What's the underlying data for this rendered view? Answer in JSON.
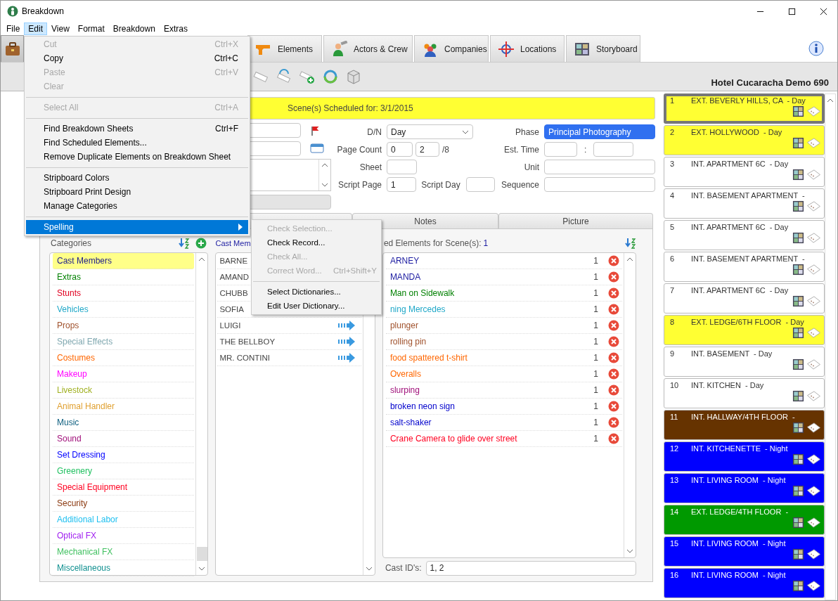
{
  "window": {
    "title": "Breakdown"
  },
  "menu_bar": [
    {
      "label": "File",
      "selected": false
    },
    {
      "label": "Edit",
      "selected": true
    },
    {
      "label": "View",
      "selected": false
    },
    {
      "label": "Format",
      "selected": false
    },
    {
      "label": "Breakdown",
      "selected": false
    },
    {
      "label": "Extras",
      "selected": false
    }
  ],
  "module_tabs": [
    {
      "kind": "briefcase",
      "selected": true
    },
    {
      "kind": "gun",
      "label": "Elements",
      "selected": false
    },
    {
      "kind": "actor",
      "label": "Actors & Crew",
      "selected": false
    },
    {
      "kind": "people",
      "label": "Companies",
      "selected": false
    },
    {
      "kind": "compass",
      "label": "Locations",
      "selected": false
    },
    {
      "kind": "storyboard",
      "label": "Storyboard",
      "selected": false
    }
  ],
  "project_name": "Hotel Cucaracha Demo 690",
  "schedule_banner": "Scene(s) Scheduled for: 3/1/2015",
  "form": {
    "dn_label": "D/N",
    "dn_value": "Day",
    "phase_label": "Phase",
    "phase_value": "Principal Photography",
    "phase_highlighted": true,
    "page_count_label": "Page Count",
    "page_count_whole": "0",
    "page_count_eighths": "2",
    "page_count_suffix": "/8",
    "est_time_label": "Est. Time",
    "est_time_separator": ":",
    "sheet_label": "Sheet",
    "unit_label": "Unit",
    "script_page_label": "Script Page",
    "script_page_value": "1",
    "script_day_label": "Script Day",
    "sequence_label": "Sequence"
  },
  "panel_tabs": [
    {
      "label": "Notes",
      "selected": false
    },
    {
      "label": "Picture",
      "selected": false
    }
  ],
  "categories": {
    "header": "Categories",
    "items": [
      {
        "label": "Cast Members",
        "color": "#1a1a8c",
        "selected": true
      },
      {
        "label": "Extras",
        "color": "#008000",
        "selected": false
      },
      {
        "label": "Stunts",
        "color": "#e00020",
        "selected": false
      },
      {
        "label": "Vehicles",
        "color": "#20a8c8",
        "selected": false
      },
      {
        "label": "Props",
        "color": "#a0522d",
        "selected": false
      },
      {
        "label": "Special Effects",
        "color": "#80a8b0",
        "selected": false
      },
      {
        "label": "Costumes",
        "color": "#ff6600",
        "selected": false
      },
      {
        "label": "Makeup",
        "color": "#ff00ff",
        "selected": false
      },
      {
        "label": "Livestock",
        "color": "#a0b020",
        "selected": false
      },
      {
        "label": "Animal Handler",
        "color": "#e0a030",
        "selected": false
      },
      {
        "label": "Music",
        "color": "#106080",
        "selected": false
      },
      {
        "label": "Sound",
        "color": "#a0107a",
        "selected": false
      },
      {
        "label": "Set Dressing",
        "color": "#0000ff",
        "selected": false
      },
      {
        "label": "Greenery",
        "color": "#20c060",
        "selected": false
      },
      {
        "label": "Special Equipment",
        "color": "#ff0020",
        "selected": false
      },
      {
        "label": "Security",
        "color": "#8b3a10",
        "selected": false
      },
      {
        "label": "Additional Labor",
        "color": "#20c0f0",
        "selected": false
      },
      {
        "label": "Optical FX",
        "color": "#a020f0",
        "selected": false
      },
      {
        "label": "Mechanical FX",
        "color": "#40c060",
        "selected": false
      },
      {
        "label": "Miscellaneous",
        "color": "#109090",
        "selected": false
      }
    ]
  },
  "cast": {
    "header": "Cast Mem",
    "items": [
      {
        "name": "BARNE",
        "arrow": false
      },
      {
        "name": "AMAND",
        "arrow": false
      },
      {
        "name": "CHUBB",
        "arrow": false
      },
      {
        "name": "SOFIA",
        "arrow": false
      },
      {
        "name": "LUIGI",
        "arrow": true
      },
      {
        "name": "THE BELLBOY",
        "arrow": true
      },
      {
        "name": "MR. CONTINI",
        "arrow": true
      }
    ]
  },
  "elements": {
    "header": "ed Elements for Scene(s):",
    "count": "1",
    "items": [
      {
        "label": "ARNEY",
        "color": "#1a1aa0",
        "quantity": "1"
      },
      {
        "label": "MANDA",
        "color": "#1a1aa0",
        "quantity": "1"
      },
      {
        "label": "Man on Sidewalk",
        "color": "#008000",
        "quantity": "1"
      },
      {
        "label": "ning Mercedes",
        "color": "#20a8c8",
        "quantity": "1"
      },
      {
        "label": "plunger",
        "color": "#a0522d",
        "quantity": "1"
      },
      {
        "label": "rolling pin",
        "color": "#a0522d",
        "quantity": "1"
      },
      {
        "label": "food spattered t-shirt",
        "color": "#ff6600",
        "quantity": "1"
      },
      {
        "label": "Overalls",
        "color": "#ff6600",
        "quantity": "1"
      },
      {
        "label": "slurping",
        "color": "#a0107a",
        "quantity": "1"
      },
      {
        "label": "broken neon sign",
        "color": "#0000cc",
        "quantity": "1"
      },
      {
        "label": "salt-shaker",
        "color": "#0000cc",
        "quantity": "1"
      },
      {
        "label": "Crane Camera to glide over street",
        "color": "#ff0020",
        "quantity": "1"
      }
    ],
    "cast_ids_label": "Cast ID's:",
    "cast_ids_value": "1, 2"
  },
  "stripboard": [
    {
      "number": "1",
      "title": "EXT. BEVERLY HILLS, CA  - Day",
      "color": "#ffff33",
      "selected": true
    },
    {
      "number": "2",
      "title": "EXT. HOLLYWOOD  - Day",
      "color": "#ffff33",
      "selected": false
    },
    {
      "number": "3",
      "title": "INT. APARTMENT 6C  - Day",
      "color": "#ffffff",
      "selected": false
    },
    {
      "number": "4",
      "title": "INT. BASEMENT APARTMENT  -",
      "color": "#ffffff",
      "selected": false
    },
    {
      "number": "5",
      "title": "INT. APARTMENT 6C  - Day",
      "color": "#ffffff",
      "selected": false
    },
    {
      "number": "6",
      "title": "INT. BASEMENT APARTMENT  -",
      "color": "#ffffff",
      "selected": false
    },
    {
      "number": "7",
      "title": "INT. APARTMENT 6C  - Day",
      "color": "#ffffff",
      "selected": false
    },
    {
      "number": "8",
      "title": "EXT. LEDGE/6TH FLOOR  - Day",
      "color": "#ffff33",
      "selected": false
    },
    {
      "number": "9",
      "title": "INT. BASEMENT  - Day",
      "color": "#ffffff",
      "selected": false
    },
    {
      "number": "10",
      "title": "INT. KITCHEN  - Day",
      "color": "#ffffff",
      "selected": false
    },
    {
      "number": "11",
      "title": "INT. HALLWAY/4TH FLOOR  -",
      "color": "#663300",
      "selected": false
    },
    {
      "number": "12",
      "title": "INT. KITCHENETTE  - Night",
      "color": "#0000ff",
      "selected": false
    },
    {
      "number": "13",
      "title": "INT. LIVING ROOM  - Night",
      "color": "#0000ff",
      "selected": false
    },
    {
      "number": "14",
      "title": "EXT. LEDGE/4TH FLOOR  -",
      "color": "#009900",
      "selected": false
    },
    {
      "number": "15",
      "title": "INT. LIVING ROOM  - Night",
      "color": "#0000ff",
      "selected": false
    },
    {
      "number": "16",
      "title": "INT. LIVING ROOM  - Night",
      "color": "#0000ff",
      "selected": false
    }
  ],
  "edit_menu": [
    {
      "kind": "item",
      "label": "Cut",
      "shortcut": "Ctrl+X",
      "disabled": true,
      "selected": false
    },
    {
      "kind": "item",
      "label": "Copy",
      "shortcut": "Ctrl+C",
      "disabled": false,
      "selected": false
    },
    {
      "kind": "item",
      "label": "Paste",
      "shortcut": "Ctrl+V",
      "disabled": true,
      "selected": false
    },
    {
      "kind": "item",
      "label": "Clear",
      "disabled": true,
      "selected": false
    },
    {
      "kind": "separator"
    },
    {
      "kind": "item",
      "label": "Select All",
      "shortcut": "Ctrl+A",
      "disabled": true,
      "selected": false
    },
    {
      "kind": "separator"
    },
    {
      "kind": "item",
      "label": "Find Breakdown Sheets",
      "shortcut": "Ctrl+F",
      "disabled": false,
      "selected": false
    },
    {
      "kind": "item",
      "label": "Find Scheduled Elements...",
      "disabled": false,
      "selected": false
    },
    {
      "kind": "item",
      "label": "Remove Duplicate Elements on Breakdown Sheet",
      "disabled": false,
      "selected": false
    },
    {
      "kind": "separator"
    },
    {
      "kind": "item",
      "label": "Stripboard Colors",
      "disabled": false,
      "selected": false
    },
    {
      "kind": "item",
      "label": "Stripboard Print Design",
      "disabled": false,
      "selected": false
    },
    {
      "kind": "item",
      "label": "Manage Categories",
      "disabled": false,
      "selected": false
    },
    {
      "kind": "separator"
    },
    {
      "kind": "submenu",
      "label": "Spelling",
      "disabled": false,
      "selected": true
    }
  ],
  "spelling_submenu": [
    {
      "kind": "item",
      "label": "Check Selection...",
      "disabled": true
    },
    {
      "kind": "item",
      "label": "Check Record...",
      "disabled": false
    },
    {
      "kind": "item",
      "label": "Check All...",
      "disabled": true
    },
    {
      "kind": "item",
      "label": "Correct Word...",
      "shortcut": "Ctrl+Shift+Y",
      "disabled": true
    },
    {
      "kind": "separator"
    },
    {
      "kind": "item",
      "label": "Select Dictionaries...",
      "disabled": false
    },
    {
      "kind": "item",
      "label": "Edit User Dictionary...",
      "disabled": false
    }
  ]
}
